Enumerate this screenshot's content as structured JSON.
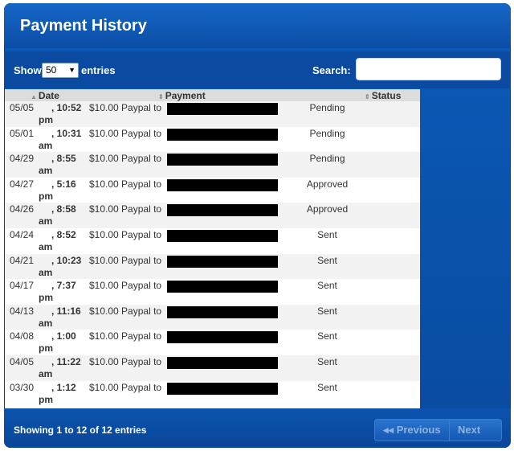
{
  "header": {
    "title": "Payment History"
  },
  "controls": {
    "show_label": "Show",
    "length_value": "50",
    "entries_label": "entries",
    "search_label": "Search:",
    "search_value": ""
  },
  "table": {
    "columns": [
      "Date",
      "Payment",
      "Status"
    ],
    "rows": [
      {
        "date": "05/05",
        "time": ", 10:52",
        "ampm": "pm",
        "amount": "$10.00 Paypal to",
        "status": "Pending"
      },
      {
        "date": "05/01",
        "time": ", 10:31",
        "ampm": "am",
        "amount": "$10.00 Paypal to",
        "status": "Pending"
      },
      {
        "date": "04/29",
        "time": ", 8:55",
        "ampm": "am",
        "amount": "$10.00 Paypal to",
        "status": "Pending"
      },
      {
        "date": "04/27",
        "time": ", 5:16",
        "ampm": "pm",
        "amount": "$10.00 Paypal to",
        "status": "Approved"
      },
      {
        "date": "04/26",
        "time": ", 8:58",
        "ampm": "am",
        "amount": "$10.00 Paypal to",
        "status": "Approved"
      },
      {
        "date": "04/24",
        "time": ", 8:52",
        "ampm": "am",
        "amount": "$10.00 Paypal to",
        "status": "Sent"
      },
      {
        "date": "04/21",
        "time": ", 10:23",
        "ampm": "am",
        "amount": "$10.00 Paypal to",
        "status": "Sent"
      },
      {
        "date": "04/17",
        "time": ", 7:37",
        "ampm": "pm",
        "amount": "$10.00 Paypal to",
        "status": "Sent"
      },
      {
        "date": "04/13",
        "time": ", 11:16",
        "ampm": "am",
        "amount": "$10.00 Paypal to",
        "status": "Sent"
      },
      {
        "date": "04/08",
        "time": ", 1:00",
        "ampm": "pm",
        "amount": "$10.00 Paypal to",
        "status": "Sent"
      },
      {
        "date": "04/05",
        "time": ", 11:22",
        "ampm": "am",
        "amount": "$10.00 Paypal to",
        "status": "Sent"
      },
      {
        "date": "03/30",
        "time": ", 1:12",
        "ampm": "pm",
        "amount": "$10.00 Paypal to",
        "status": "Sent"
      }
    ]
  },
  "footer": {
    "info": "Showing 1 to 12 of 12 entries",
    "prev_label": "Previous",
    "next_label": "Next"
  }
}
